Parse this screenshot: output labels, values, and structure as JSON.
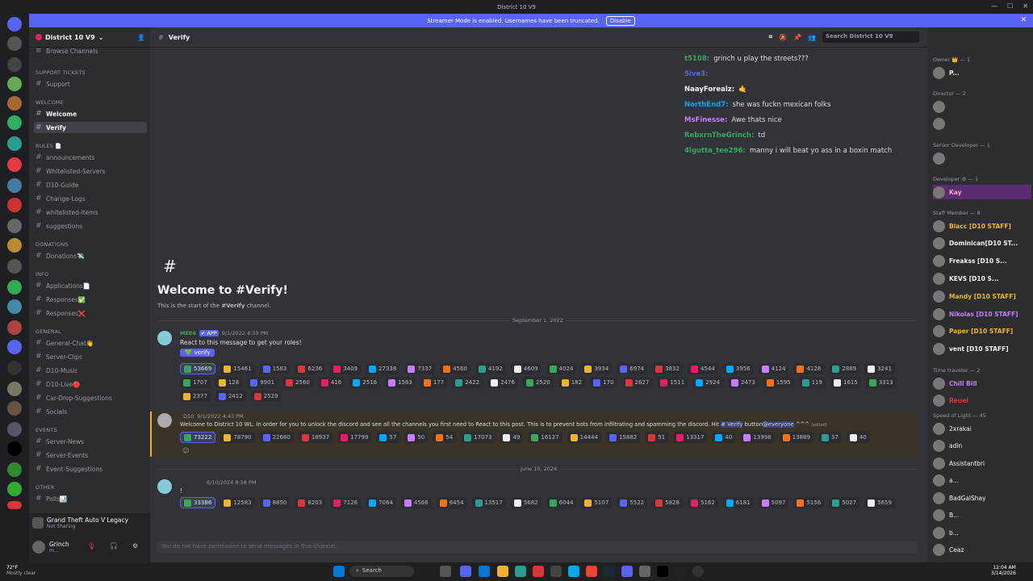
{
  "window": {
    "title": "District 10 V9"
  },
  "streamer": {
    "text": "Streamer Mode is enabled. Usernames have been truncated.",
    "disable": "Disable"
  },
  "server": {
    "name": "District 10 V9"
  },
  "sidebar": {
    "browse": "Browse Channels",
    "cat_support": "SUPPORT TICKETS",
    "support": "Support",
    "cat_welcome": "WELCOME",
    "welcome": "Welcome",
    "verify": "Verify",
    "cat_rules": "RULES 📄",
    "ch_rules": [
      "announcements",
      "Whitelisted-Servers",
      "D10-Guide",
      "Change-Logs",
      "whitelisted-items",
      "suggestions"
    ],
    "cat_donations": "DONATIONS",
    "donations": "Donations💸",
    "cat_info": "INFO",
    "ch_info": [
      "Applications📄",
      "Responses✅",
      "Responses❌"
    ],
    "cat_general": "GENERAL",
    "ch_general": [
      "General-Chat👋",
      "Server-Clips",
      "D10-Music",
      "D10-Live🔴",
      "Car-Drop-Suggestions",
      "Socials"
    ],
    "cat_events": "EVENTS",
    "ch_events": [
      "Server-News",
      "Server-Events",
      "Event-Suggestions"
    ],
    "cat_other": "OTHER",
    "polls": "Polls📊"
  },
  "activity": {
    "game": "Grand Theft Auto V Legacy",
    "status": "Not Sharing"
  },
  "user": {
    "name": "Grinch",
    "sub": "m..."
  },
  "chat": {
    "channel": "Verify",
    "search_placeholder": "Search District 10 V9",
    "lines": [
      {
        "name": "t5108:",
        "text": "grinch u play the streets???",
        "color": "#3ba55c"
      },
      {
        "name": "5ive3:",
        "text": "",
        "color": "#5865f2"
      },
      {
        "name": "NaayForealz:",
        "text": "🤙",
        "color": "#f2f3f5"
      },
      {
        "name": "NorthEnd7:",
        "text": "she was fuckn mexican folks",
        "color": "#00a8fc"
      },
      {
        "name": "MsFinesse:",
        "text": "Awe thats nice",
        "color": "#c77dff"
      },
      {
        "name": "RebxrnTheGrinch:",
        "text": "td",
        "color": "#3ba55c"
      },
      {
        "name": "4lgutta_tee296:",
        "text": "manny i will beat yo ass in a boxin match",
        "color": "#3ba55c"
      }
    ],
    "welcome_title": "Welcome to #Verify!",
    "welcome_sub_pre": "This is the start of the ",
    "welcome_sub_ch": "#Verify",
    "welcome_sub_post": " channel.",
    "date1": "September 1, 2022",
    "m1": {
      "author": "MEE6",
      "badge": "✔ APP",
      "time": "9/1/2022 4:33 PM",
      "text": "React to this message to get your roles!",
      "button": "verify"
    },
    "reacts1": [
      53669,
      15461,
      1583,
      6236,
      3409,
      27338,
      7337,
      4560,
      4192,
      4609,
      4024,
      3934,
      6974,
      3832,
      4544,
      3956,
      4124,
      4128,
      2889,
      3241,
      1707,
      128,
      9901,
      2560,
      416,
      2516,
      1563,
      177,
      2422,
      2476,
      2520,
      182,
      170,
      2627,
      1511,
      2924,
      2473,
      1595,
      119,
      1615,
      3313,
      2377,
      2412,
      2529
    ],
    "m2": {
      "author": "",
      "badge": "D10",
      "time": "9/1/2022 4:43 PM",
      "text_pre": "Welcome to District 10 WL. In order for you to unlock the discord and see all the channels you first need to React to this post. This is to prevent bots from infiltrating and spamming the discord. Hit ",
      "ch": "# Verify",
      "text_mid": " button",
      "mention": "@everyone",
      "text_post": " ^^^",
      "edited": "(edited)"
    },
    "reacts2": [
      73222,
      78790,
      22680,
      18937,
      17799,
      57,
      50,
      54,
      17073,
      49,
      16127,
      14444,
      15882,
      51,
      13317,
      40,
      13998,
      13889,
      37,
      40
    ],
    "date2": "June 10, 2024",
    "m3": {
      "time": "6/10/2024 8:58 PM",
      "text": "!"
    },
    "reacts3": [
      33386,
      12583,
      8850,
      8203,
      7126,
      7064,
      4566,
      6454,
      13517,
      5682,
      6044,
      5107,
      5522,
      5828,
      5162,
      6181,
      5097,
      5156,
      5027,
      5659
    ],
    "no_perm": "You do not have permission to send messages in this channel."
  },
  "members": {
    "owner": "Owner 👑 — 1",
    "director": "Director — 2",
    "senior": "Senior Developer — 1",
    "developer": "Developer ⚙ — 1",
    "staff": "Staff Member — 8",
    "staff_list": [
      "Blacc [D10 STAFF]",
      "Dominican[D10 ST...",
      "Freakss [D10 S...",
      "KEVS [D10 S...",
      "Mandy [D10 STAFF]",
      "Nikolas [D10 STAFF]",
      "Paper [D10 STAFF]",
      "vent [D10 STAFF]"
    ],
    "time_traveler": "Time traveler — 2",
    "time_list": [
      "Chill Bill",
      "Reuel"
    ],
    "speed": "Speed of Light — 45",
    "speed_list": [
      "2xrakai",
      "adin",
      "Assistantbri",
      "a...",
      "BadGalShay",
      "B...",
      "b...",
      "Ceaz"
    ]
  },
  "taskbar": {
    "weather": "72°F",
    "weather_sub": "Mostly clear",
    "search": "Search",
    "time": "12:04 AM",
    "date": "3/14/2026"
  }
}
